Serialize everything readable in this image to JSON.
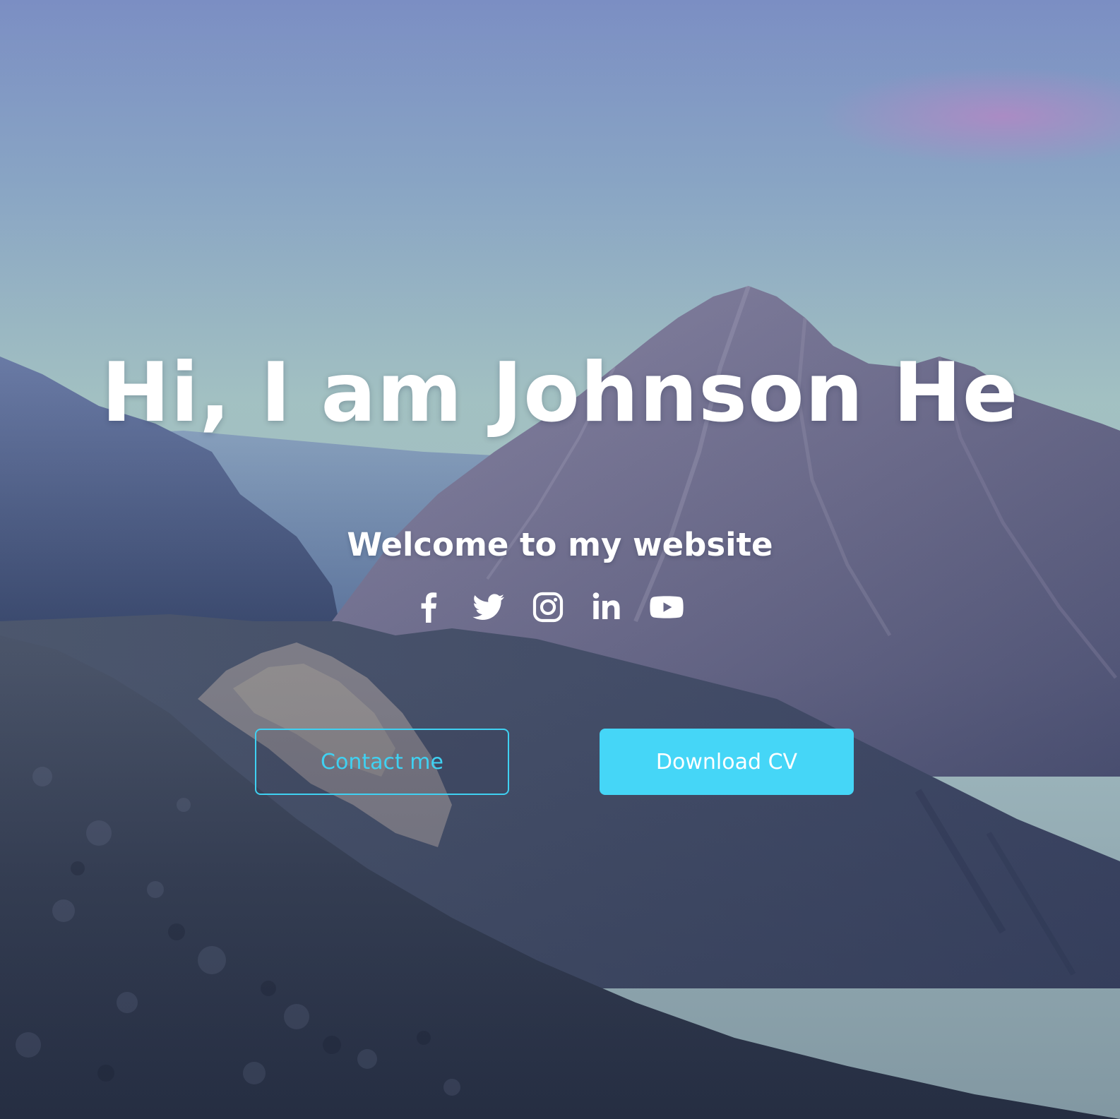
{
  "hero": {
    "title": "Hi, I am Johnson He",
    "subtitle": "Welcome to my website"
  },
  "social_links": [
    {
      "name": "facebook",
      "icon": "facebook-icon"
    },
    {
      "name": "twitter",
      "icon": "twitter-icon"
    },
    {
      "name": "instagram",
      "icon": "instagram-icon"
    },
    {
      "name": "linkedin",
      "icon": "linkedin-icon"
    },
    {
      "name": "youtube",
      "icon": "youtube-icon"
    }
  ],
  "buttons": {
    "contact_label": "Contact me",
    "download_label": "Download CV"
  },
  "colors": {
    "accent": "#45d6f7",
    "text": "#ffffff",
    "sky_top": "#7b8ec3",
    "sky_bottom": "#a9c7c9"
  }
}
